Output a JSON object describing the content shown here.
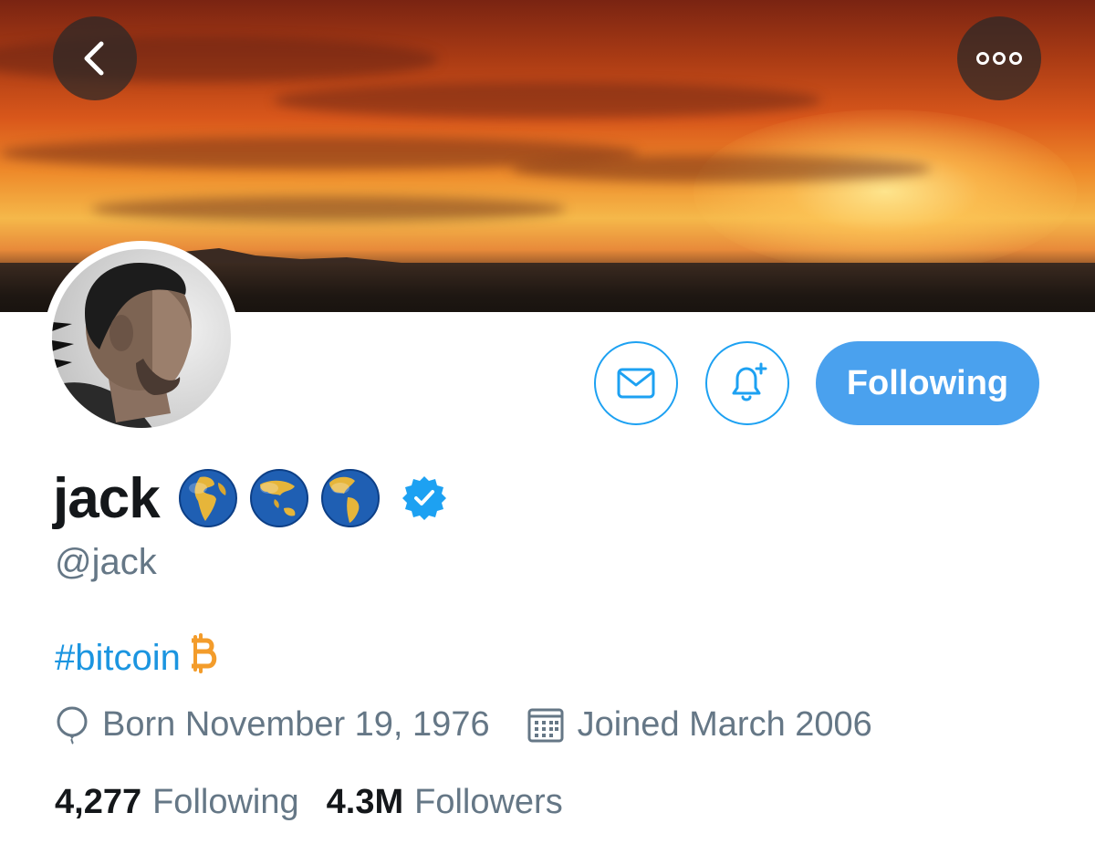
{
  "profile": {
    "display_name": "jack",
    "name_emojis": [
      "globe-europe-africa",
      "globe-asia-australia",
      "globe-americas"
    ],
    "verified": true,
    "handle": "@jack",
    "bio_hashtag": "#bitcoin",
    "bio_symbol": "B",
    "born": "Born November 19, 1976",
    "joined": "Joined March 2006"
  },
  "actions": {
    "follow_label": "Following",
    "message_icon": "envelope-icon",
    "notify_icon": "bell-plus-icon"
  },
  "nav": {
    "back_icon": "chevron-left-icon",
    "more_icon": "ellipsis-icon"
  },
  "stats": {
    "following_count": "4,277",
    "following_label": "Following",
    "followers_count": "4.3M",
    "followers_label": "Followers"
  },
  "colors": {
    "accent": "#1da1f2",
    "follow_button_bg": "#4aa1ee",
    "link": "#1b95e0",
    "secondary_text": "#657786",
    "bitcoin": "#f39c2b",
    "verified": "#1da1f2"
  }
}
